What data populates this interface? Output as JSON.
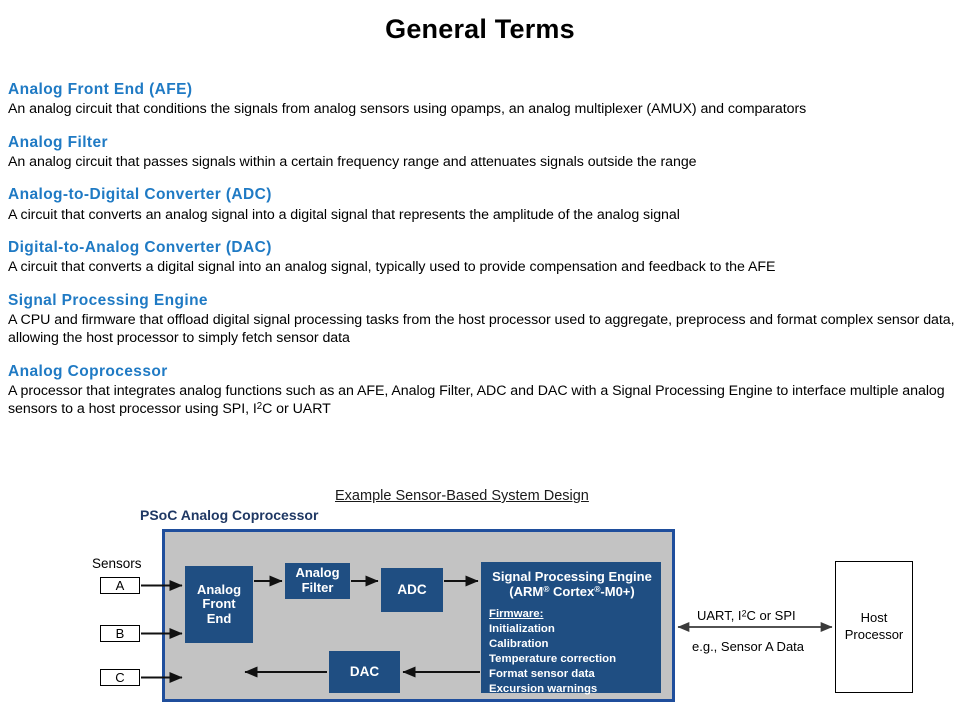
{
  "slide": {
    "title": "General Terms"
  },
  "glossary": [
    {
      "heading": "Analog Front End (AFE)",
      "definition": "An analog circuit that conditions the signals from analog sensors using opamps, an analog multiplexer (AMUX) and comparators"
    },
    {
      "heading": "Analog Filter",
      "definition": "An analog circuit that passes signals within a certain frequency range and attenuates signals outside the range"
    },
    {
      "heading": "Analog-to-Digital Converter (ADC)",
      "definition": "A circuit that converts an analog signal into a digital signal that represents the amplitude of the analog signal"
    },
    {
      "heading": "Digital-to-Analog Converter (DAC)",
      "definition": "A circuit that converts a digital signal into an analog signal, typically used to provide compensation and feedback to the AFE"
    },
    {
      "heading": "Signal Processing Engine",
      "definition": "A CPU and firmware that offload digital signal processing tasks from the host processor used to aggregate, preprocess and format complex sensor data, allowing the host processor to simply fetch sensor data"
    },
    {
      "heading": "Analog Coprocessor",
      "definition_part1": "A processor that integrates analog functions such as an AFE, Analog Filter, ADC and DAC with a Signal Processing Engine to interface multiple analog sensors to a host processor using SPI, I",
      "definition_sup": "2",
      "definition_part2": "C or UART"
    }
  ],
  "diagram": {
    "caption": "Example Sensor-Based System Design",
    "coprocessor_label": "PSoC Analog Coprocessor",
    "sensors_label": "Sensors",
    "sensors": [
      "A",
      "B",
      "C"
    ],
    "blocks": {
      "afe": [
        "Analog",
        "Front",
        "End"
      ],
      "filter": [
        "Analog",
        "Filter"
      ],
      "adc": "ADC",
      "dac": "DAC",
      "spe": {
        "title_line1": "Signal Processing Engine",
        "title_line2_pre": "(ARM",
        "title_line2_sup1": "®",
        "title_line2_mid": " Cortex",
        "title_line2_sup2": "®",
        "title_line2_post": "-M0+)",
        "firmware_heading": "Firmware:",
        "firmware_items": [
          "Initialization",
          "Calibration",
          "Temperature correction",
          "Format sensor data",
          "Excursion warnings"
        ]
      }
    },
    "host_processor": [
      "Host",
      "Processor"
    ],
    "interface_label_pre": "UART, I",
    "interface_label_sup": "2",
    "interface_label_post": "C or SPI",
    "interface_example": "e.g., Sensor A Data"
  },
  "colors": {
    "heading_blue": "#1f7ac4",
    "block_blue": "#1f4e82",
    "frame_blue": "#1f4e9c",
    "frame_gray": "#c3c3c3",
    "navy_label": "#1f3864"
  }
}
